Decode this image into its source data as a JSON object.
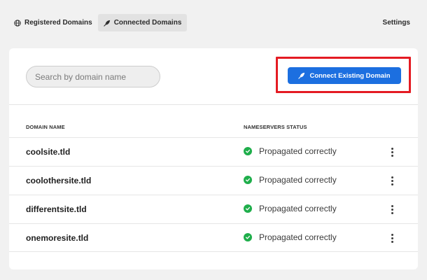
{
  "nav": {
    "tabs": [
      {
        "label": "Registered Domains",
        "icon": "globe-icon",
        "active": false
      },
      {
        "label": "Connected Domains",
        "icon": "feather-icon",
        "active": true
      }
    ],
    "settings_label": "Settings"
  },
  "toolbar": {
    "search_placeholder": "Search by domain name",
    "connect_label": "Connect Existing Domain",
    "connect_icon": "feather-icon"
  },
  "table": {
    "columns": [
      "DOMAIN NAME",
      "NAMESERVERS STATUS"
    ],
    "rows": [
      {
        "domain": "coolsite.tld",
        "status": "Propagated correctly"
      },
      {
        "domain": "coolothersite.tld",
        "status": "Propagated correctly"
      },
      {
        "domain": "differentsite.tld",
        "status": "Propagated correctly"
      },
      {
        "domain": "onemoresite.tld",
        "status": "Propagated correctly"
      }
    ]
  },
  "colors": {
    "accent": "#1c6fe0",
    "highlight": "#e41b23",
    "success": "#1fae4b",
    "background": "#f1f1f1"
  }
}
